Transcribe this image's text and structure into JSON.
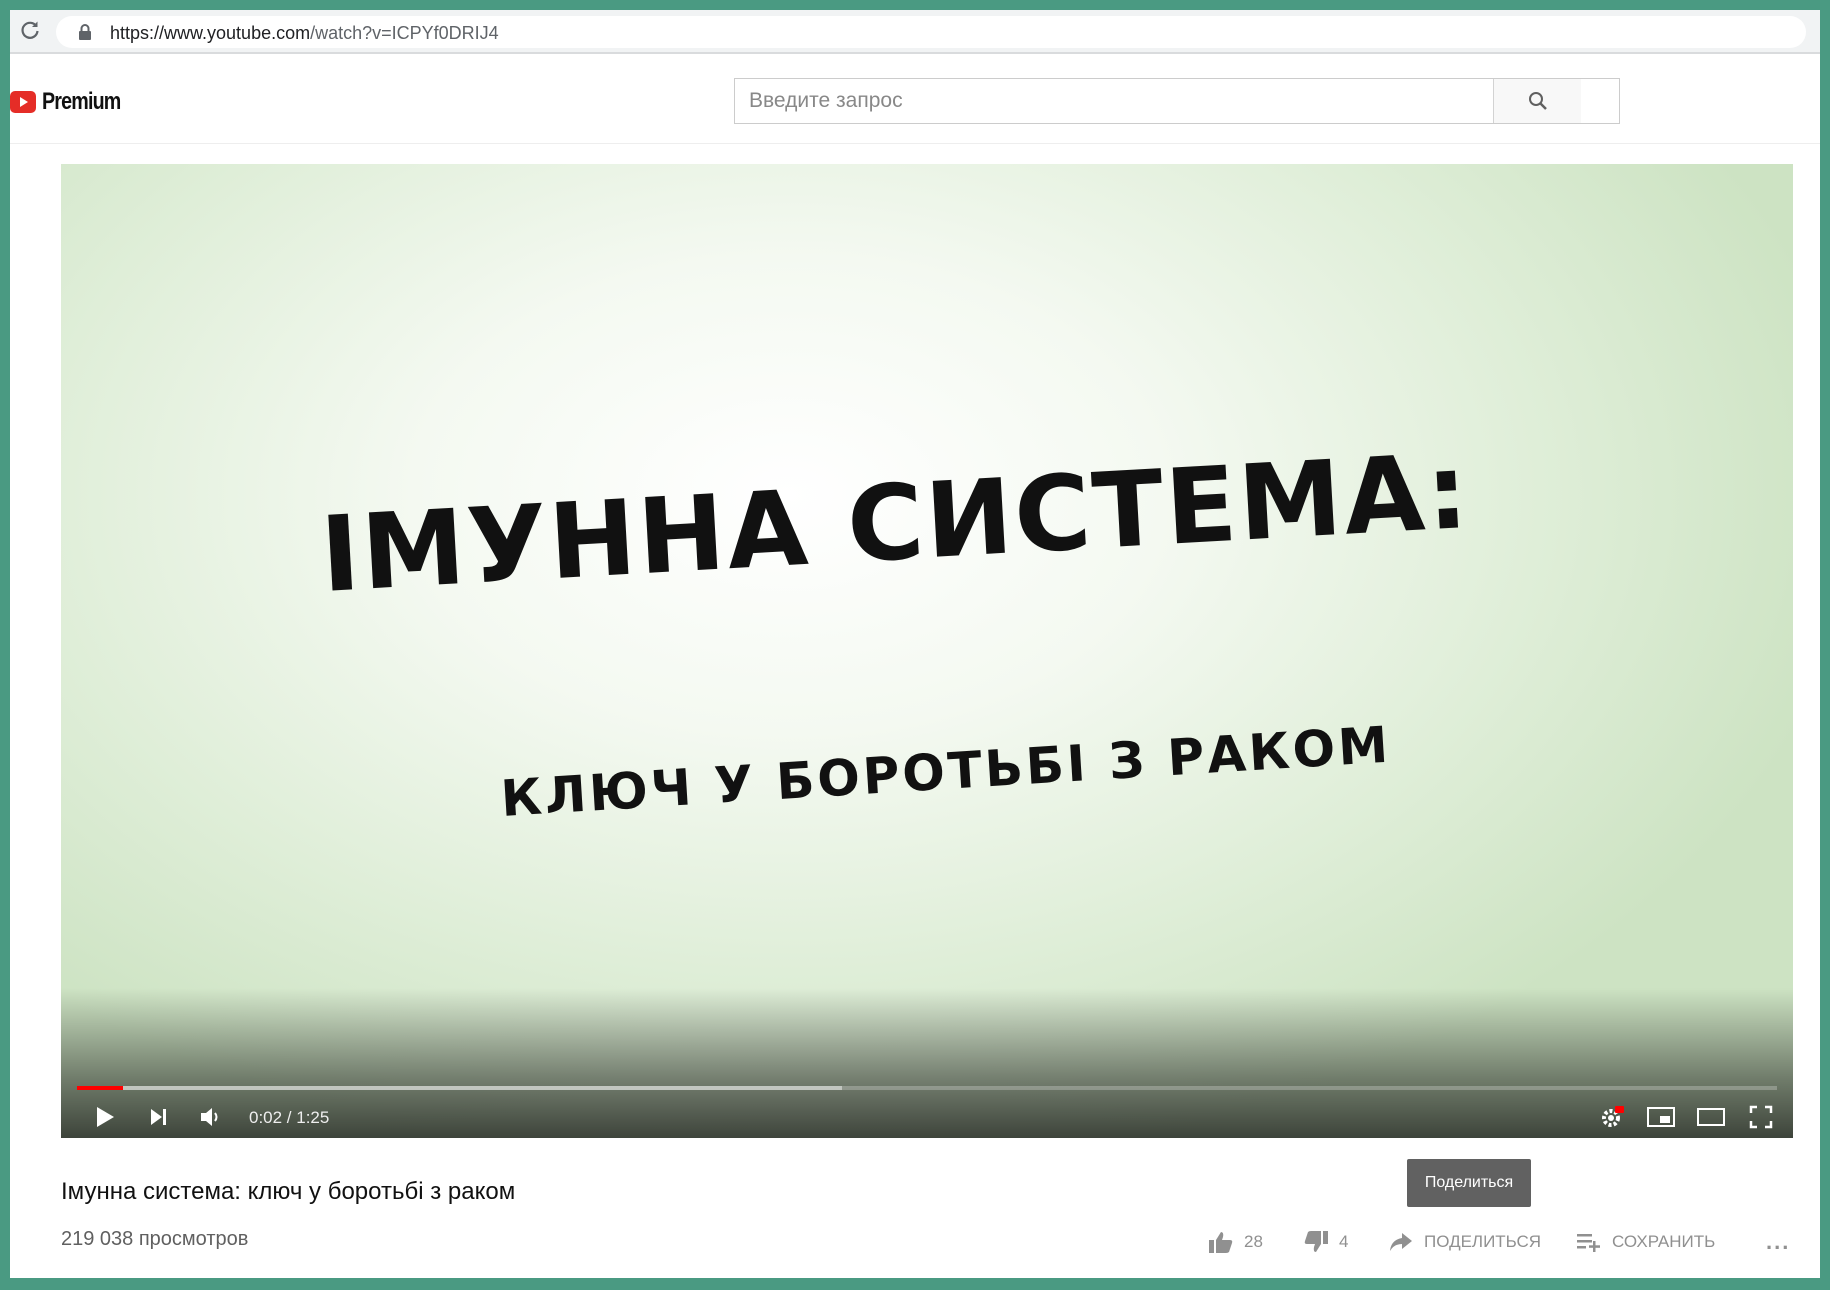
{
  "browser": {
    "url_host": "https://www.youtube.com",
    "url_path": "/watch?v=ICPYf0DRIJ4"
  },
  "header": {
    "logo_text": "Premium",
    "search_placeholder": "Введите запрос"
  },
  "player": {
    "title_line1": "Імунна система:",
    "title_line2": "ключ у боротьбі з раком",
    "time": "0:02 / 1:25",
    "progress_played_fraction": 0.027,
    "progress_buffered_fraction": 0.45
  },
  "video": {
    "title": "Імунна система: ключ у боротьбі з раком",
    "views": "219 038 просмотров",
    "likes": "28",
    "dislikes": "4",
    "share_label": "ПОДЕЛИТЬСЯ",
    "save_label": "СОХРАНИТЬ",
    "more_label": "...",
    "tooltip": "Поделиться"
  },
  "colors": {
    "accent": "#ff0000",
    "frame": "#4a9a82"
  }
}
